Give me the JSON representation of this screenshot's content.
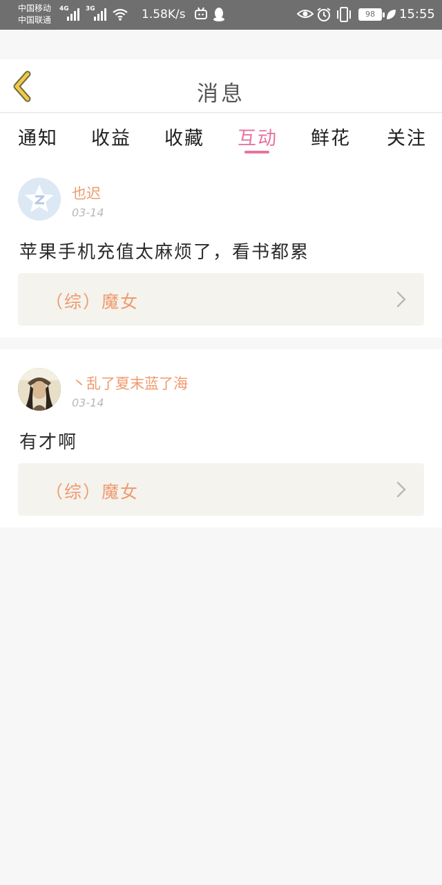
{
  "status_bar": {
    "carrier1": "中国移动",
    "carrier2": "中国联通",
    "net1": "4G",
    "net2": "3G",
    "speed": "1.58K/s",
    "battery": "98",
    "time": "15:55"
  },
  "header": {
    "title": "消息"
  },
  "tabs": [
    {
      "label": "通知"
    },
    {
      "label": "收益"
    },
    {
      "label": "收藏"
    },
    {
      "label": "互动"
    },
    {
      "label": "鲜花"
    },
    {
      "label": "关注"
    }
  ],
  "active_tab": "互动",
  "messages": [
    {
      "username": "也迟",
      "date": "03-14",
      "comment": "苹果手机充值太麻烦了，看书都累",
      "book_title": "（综）魔女"
    },
    {
      "username": "丶乱了夏末蓝了海",
      "date": "03-14",
      "comment": "有才啊",
      "book_title": "（综）魔女"
    }
  ],
  "colors": {
    "accent": "#e7739f",
    "name": "#f09a6e",
    "status_bar": "#6f6f6f",
    "back_arrow": "#f2c94c"
  }
}
